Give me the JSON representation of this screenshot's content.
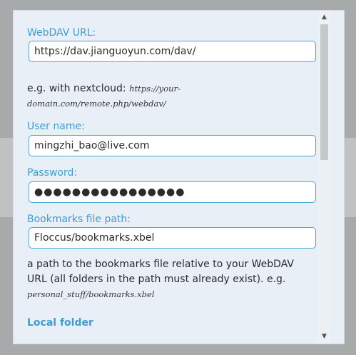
{
  "dialog": {
    "close_glyph": "✕",
    "webdav_url": {
      "label": "WebDAV URL:",
      "value": "https://dav.jianguoyun.com/dav/"
    },
    "example_hint": {
      "prefix": "e.g. with nextcloud: ",
      "code": "https://your-domain.com/remote.php/webdav/"
    },
    "username": {
      "label": "User name:",
      "value": "mingzhi_bao@live.com"
    },
    "password": {
      "label": "Password:",
      "value": "●●●●●●●●●●●●●●●●"
    },
    "bookmarks_path": {
      "label": "Bookmarks file path:",
      "value": "Floccus/bookmarks.xbel"
    },
    "path_hint": {
      "text": "a path to the bookmarks file relative to your WebDAV URL (all folders in the path must already exist). e.g. ",
      "code": "personal_stuff/bookmarks.xbel"
    },
    "local_folder_heading": "Local folder"
  },
  "scrollbar": {
    "up_glyph": "▲",
    "down_glyph": "▼"
  }
}
